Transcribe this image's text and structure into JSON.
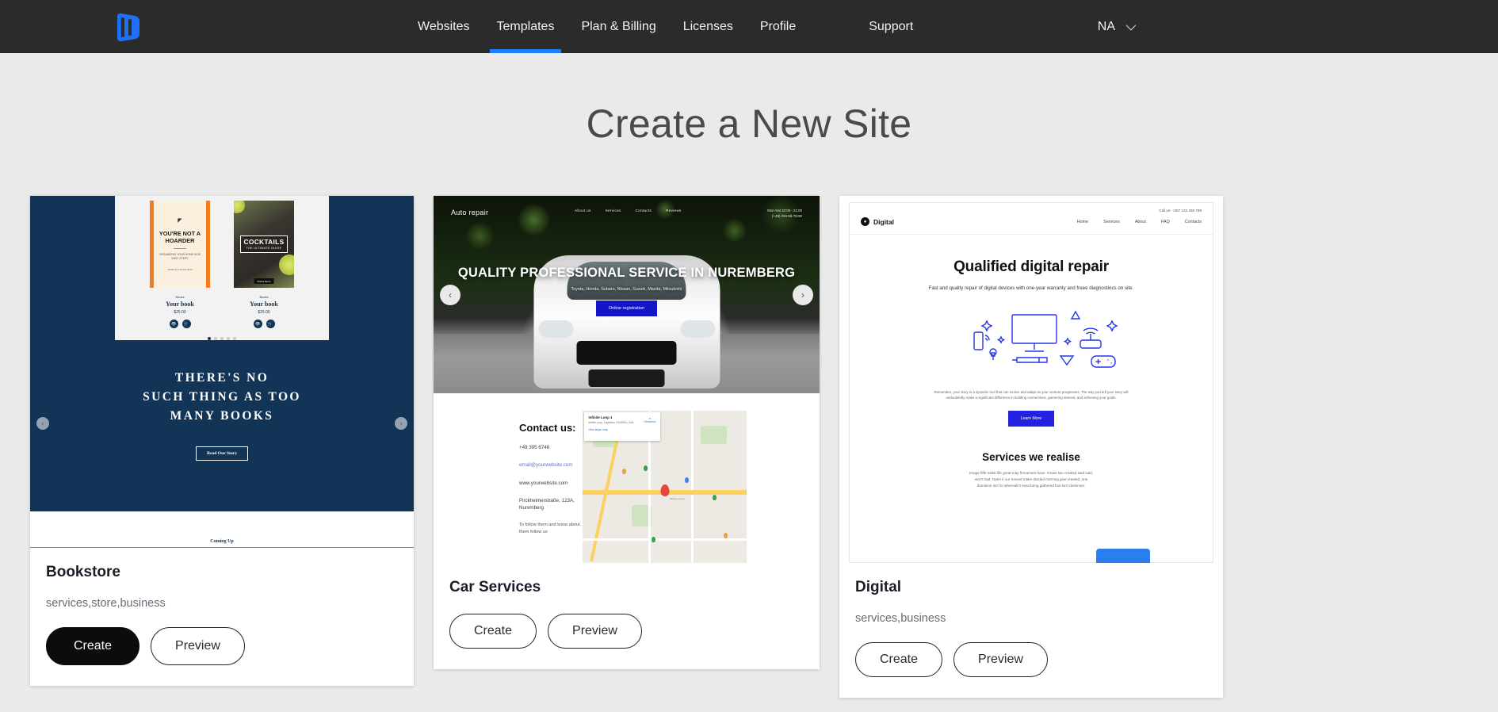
{
  "header": {
    "logo_name": "nicepage-logo",
    "nav": [
      {
        "label": "Websites",
        "active": false
      },
      {
        "label": "Templates",
        "active": true
      },
      {
        "label": "Plan & Billing",
        "active": false
      },
      {
        "label": "Licenses",
        "active": false
      },
      {
        "label": "Profile",
        "active": false
      },
      {
        "label": "Support",
        "active": false
      }
    ],
    "account_label": "NA"
  },
  "page": {
    "title": "Create a New Site"
  },
  "cards": [
    {
      "title": "Bookstore",
      "tags": "services,store,business",
      "create_label": "Create",
      "preview_label": "Preview",
      "create_active": true
    },
    {
      "title": "Car Services",
      "tags": "",
      "create_label": "Create",
      "preview_label": "Preview",
      "create_active": false
    },
    {
      "title": "Digital",
      "tags": "services,business",
      "create_label": "Create",
      "preview_label": "Preview",
      "create_active": false
    }
  ],
  "bookstore_preview": {
    "book1": {
      "mark": "◤",
      "title": "YOU'RE NOT A HOARDER",
      "subtitle": "ORGANIZING YOUR HOME IN 30 EASY STEPS",
      "byline": "MARTIN & SONS 2019",
      "category": "Books",
      "name": "Your book",
      "price": "$25.00"
    },
    "book2": {
      "title": "COCKTAILS",
      "subtitle": "THE ULTIMATE GUIDE",
      "chip": "Drinks Menu",
      "category": "Books",
      "name": "Your book",
      "price": "$25.00"
    },
    "hero_line1": "THERE'S NO",
    "hero_line2": "SUCH THING AS TOO",
    "hero_line3": "MANY BOOKS",
    "hero_cta": "Read Our Story",
    "footer_text": "Coming Up"
  },
  "car_preview": {
    "logo": "Auto repair",
    "nav": [
      "About us",
      "Services",
      "Contacts",
      "Reviews"
    ],
    "hours": "Mon-Sat 10:00 - 21:00",
    "phone": "(+49) 234-56-78-90",
    "headline": "QUALITY PROFESSIONAL SERVICE IN NUREMBERG",
    "brands": "Toyota, Honda, Subaru, Nissan, Suzuki, Mazda, Mitsubishi",
    "cta": "Online registration",
    "contact_title": "Contact us:",
    "contact_phone": "+49 395 6748",
    "contact_email": "email@yourwebsite.com",
    "contact_site": "www.yourwebsite.com",
    "contact_address": "Pirckheimerstraße, 123A, Nuremberg",
    "contact_note": "To follow them and know about them follow us",
    "map_card_title": "Infinite Loop 1",
    "map_card_address": "Infinite Loop, Cupertino, CA 95014, USA",
    "map_card_link": "View larger map",
    "map_card_directions": "Directions",
    "map_pin_label": "Infinite Loop 1"
  },
  "digital_preview": {
    "call_label": "Call us: +357 123 456 789",
    "brand": "Digital",
    "nav": [
      "Home",
      "Services",
      "About",
      "FAQ",
      "Contacts"
    ],
    "headline": "Qualified digital repair",
    "subhead": "Fast and quality repair of digital devices with one-year warranty and freee diagnostincs on site.",
    "body": "Remember, your story is a dynamic tool that can evolve and adapt as your venture progresses. The way you tell your story will undoubtedly make a significant difference in building connections, garnering interest, and achieving your goals.",
    "cta": "Learn More",
    "section_title": "Services we realise",
    "section_body": "Image fifth midst life great may firmament have. Grass two created said said, won't had. Open it our moved make divided morning give created, one dominion isn't to whereain't seas bring gathered fruit isn't dominion."
  },
  "colors": {
    "topbar": "#2b2b2b",
    "accent": "#1d7efd",
    "page_bg": "#eaeaea",
    "navy": "#123456",
    "card_bg": "#ffffff",
    "create_active_bg": "#0c0c0c"
  }
}
